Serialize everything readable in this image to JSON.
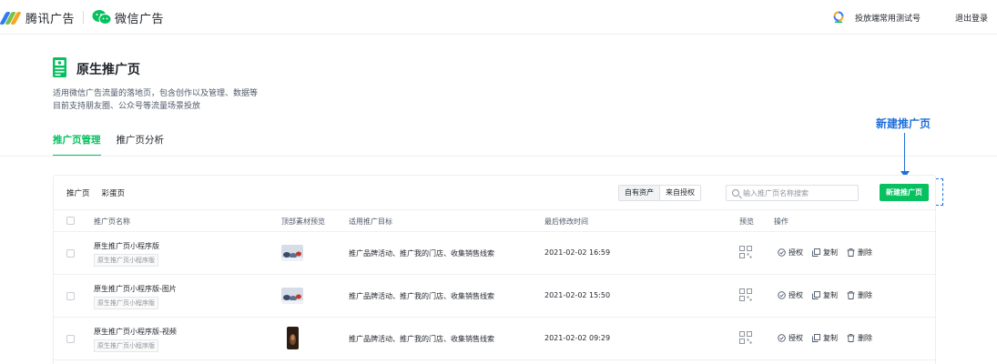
{
  "topbar": {
    "brand_tencent": "腾讯广告",
    "brand_wechat": "微信广告",
    "account_name": "投放端常用测试号",
    "logout_label": "退出登录"
  },
  "page": {
    "title": "原生推广页",
    "desc_line1": "适用微信广告流量的落地页，包含创作以及管理、数据等",
    "desc_line2": "目前支持朋友圈、公众号等流量场景投放",
    "tabs": [
      {
        "label": "推广页管理",
        "active": true
      },
      {
        "label": "推广页分析",
        "active": false
      }
    ]
  },
  "annotation": {
    "label": "新建推广页"
  },
  "card": {
    "subtabs": [
      "推广页",
      "彩蛋页"
    ],
    "segment": [
      "自有资产",
      "来自授权"
    ],
    "search_placeholder": "输入推广页名称搜索",
    "new_button": "新建推广页",
    "columns": [
      "推广页名称",
      "顶部素材预览",
      "适用推广目标",
      "最后修改时间",
      "预览",
      "操作"
    ],
    "rows": [
      {
        "name": "原生推广页小程序版",
        "tag": "原生推广页小程序版",
        "target": "推广品牌活动、推广我的门店、收集销售线索",
        "time": "2021-02-02 16:59",
        "thumb": "photo"
      },
      {
        "name": "原生推广页小程序版-图片",
        "tag": "原生推广页小程序版",
        "target": "推广品牌活动、推广我的门店、收集销售线索",
        "time": "2021-02-02 15:50",
        "thumb": "photo"
      },
      {
        "name": "原生推广页小程序版-视频",
        "tag": "原生推广页小程序版",
        "target": "推广品牌活动、推广我的门店、收集销售线索",
        "time": "2021-02-02 09:29",
        "thumb": "video"
      }
    ],
    "ops": {
      "authorize": "授权",
      "copy": "复制",
      "delete": "删除"
    }
  },
  "colors": {
    "accent_green": "#07c160",
    "annotation_blue": "#1e6fd9",
    "text": "#1f2329",
    "muted": "#8f959e"
  },
  "icons": {
    "brand": [
      "tencent-ads-logo-icon",
      "wechat-logo-icon"
    ],
    "account": "account-avatar-icon",
    "page": "document-page-icon",
    "search": "search-icon",
    "qr": "qr-code-icon",
    "ops": [
      "check-circle-icon",
      "copy-icon",
      "trash-icon"
    ]
  }
}
